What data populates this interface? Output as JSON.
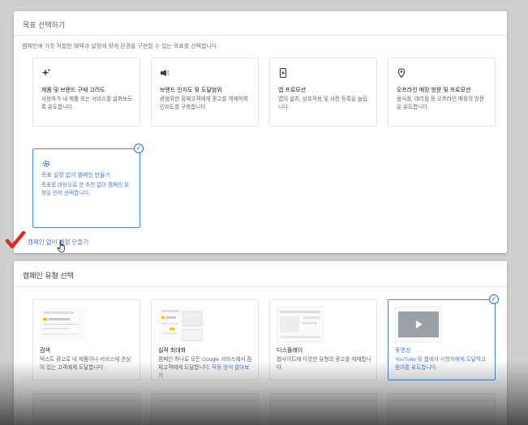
{
  "goal_section": {
    "title": "목표 선택하기",
    "subtitle": "캠페인에 가장 적합한 혜택과 설정에 맞게 환경을 구현할 수 있는 목표를 선택합니다.",
    "tiles": [
      {
        "icon": "sparkle-icon",
        "title": "제품 및 브랜드 구매 고려도",
        "desc": "사용자가 내 제품 또는 서비스를 살펴보도록 유도합니다."
      },
      {
        "icon": "megaphone-icon",
        "title": "브랜드 인지도 및 도달범위",
        "desc": "광범위한 잠재고객에게 광고를 게재하여 인지도를 구축합니다."
      },
      {
        "icon": "phone-icon",
        "title": "앱 프로모션",
        "desc": "앱의 설치, 상호작용 및 사전 등록을 늘립니다."
      },
      {
        "icon": "location-pin-icon",
        "title": "오프라인 매장 방문 및 프로모션",
        "desc": "음식점, 대리점 등 오프라인 매장의 방문을 유도합니다."
      },
      {
        "icon": "gear-icon",
        "title": "목표 설정 없이 캠페인 만들기",
        "desc": "목표를 바탕으로 한 추천 없이 캠페인 유형을 먼저 선택합니다.",
        "selected": true
      }
    ],
    "link": "캠페인 없이 계정 만들기"
  },
  "type_section": {
    "title": "캠페인 유형 선택",
    "tiles": [
      {
        "title": "검색",
        "desc": "텍스트 광고로 내 제품이나 서비스에 관심이 있는 고객에게 도달합니다."
      },
      {
        "title": "실적 최대화",
        "desc": "캠페인 하나로 모든 Google 서비스에서 잠재고객에게 도달합니다.",
        "link": "작동 방식 알아보기"
      },
      {
        "title": "디스플레이",
        "desc": "웹사이트에 다양한 유형의 광고를 게재합니다."
      },
      {
        "title": "동영상",
        "desc": "YouTube 및 웹에서 시청자에게 도달하고 참여를 유도합니다.",
        "selected": true
      }
    ]
  },
  "colors": {
    "accent": "#1a73e8",
    "annotation_red": "#e5281e",
    "link": "#4a7bd0"
  }
}
